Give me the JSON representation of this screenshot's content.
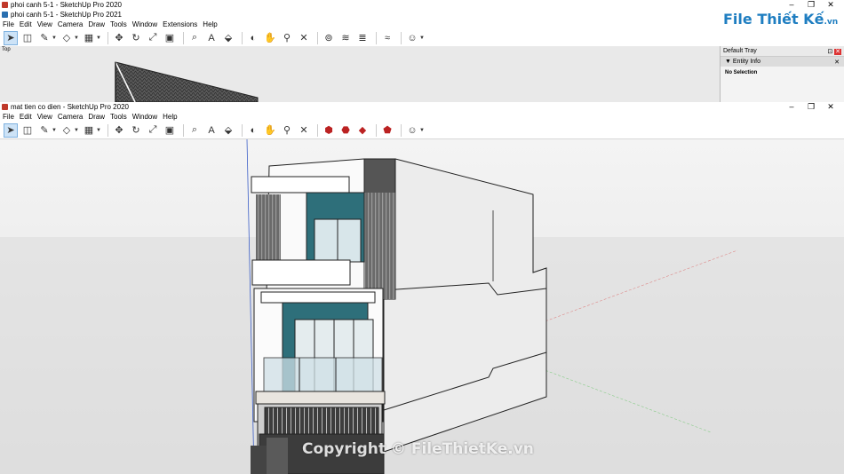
{
  "back_windows": {
    "titles": [
      "phoi canh 5-1 - SketchUp Pro 2020",
      "phoi canh 5-1 - SketchUp Pro 2021"
    ],
    "menu": [
      "File",
      "Edit",
      "View",
      "Camera",
      "Draw",
      "Tools",
      "Window",
      "Extensions",
      "Help"
    ],
    "viewport_label": "Top"
  },
  "front_window": {
    "title": "mat tien co dien - SketchUp Pro 2020",
    "menu": [
      "File",
      "Edit",
      "View",
      "Camera",
      "Draw",
      "Tools",
      "Window",
      "Help"
    ]
  },
  "tray": {
    "title": "Default Tray",
    "panel": "Entity Info",
    "body": "No Selection"
  },
  "branding": {
    "logo_main": "File Thiết Kế",
    "logo_suffix": ".vn",
    "watermark": "Copyright © FileThietKe.vn"
  },
  "colors": {
    "teal_wall": "#2e6f7a",
    "glass": "#cfe0e6",
    "dark": "#3c3c3c",
    "brand": "#1f7ec1"
  }
}
